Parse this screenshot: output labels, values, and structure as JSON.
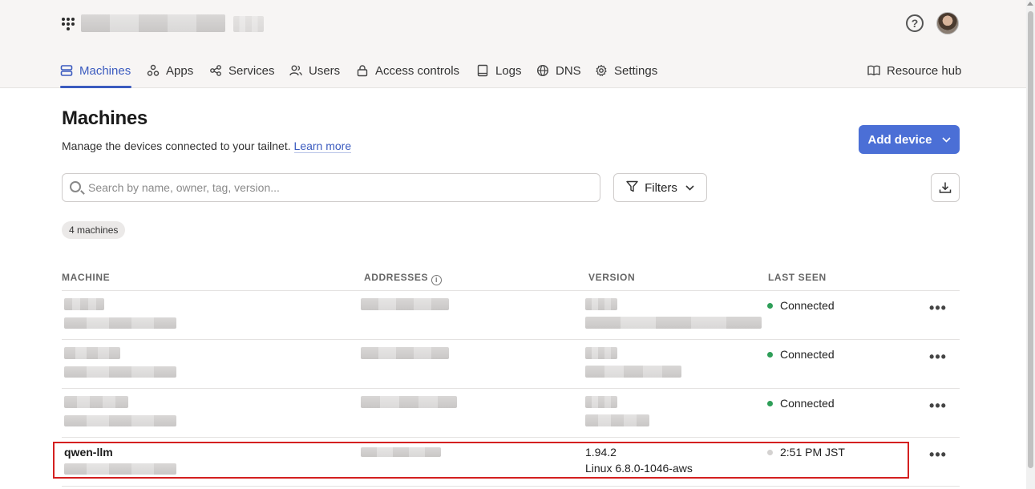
{
  "nav": {
    "items": [
      {
        "label": "Machines",
        "icon": "machines-icon",
        "active": true
      },
      {
        "label": "Apps",
        "icon": "apps-icon"
      },
      {
        "label": "Services",
        "icon": "services-icon"
      },
      {
        "label": "Users",
        "icon": "users-icon"
      },
      {
        "label": "Access controls",
        "icon": "lock-icon"
      },
      {
        "label": "Logs",
        "icon": "book-icon"
      },
      {
        "label": "DNS",
        "icon": "globe-icon"
      },
      {
        "label": "Settings",
        "icon": "gear-icon"
      }
    ],
    "resource_hub": "Resource hub",
    "help_icon": "?"
  },
  "page": {
    "title": "Machines",
    "description": "Manage the devices connected to your tailnet.",
    "learn_more": "Learn more",
    "add_device": "Add device"
  },
  "search": {
    "placeholder": "Search by name, owner, tag, version..."
  },
  "filters_label": "Filters",
  "machine_count": "4 machines",
  "table": {
    "headers": {
      "machine": "MACHINE",
      "addresses": "ADDRESSES",
      "version": "VERSION",
      "last_seen": "LAST SEEN"
    },
    "rows": [
      {
        "name": "",
        "status": "Connected",
        "online": true
      },
      {
        "name": "",
        "status": "Connected",
        "online": true
      },
      {
        "name": "",
        "status": "Connected",
        "online": true
      },
      {
        "name": "qwen-llm",
        "version": "1.94.2",
        "os": "Linux 6.8.0-1046-aws",
        "status": "2:51 PM JST",
        "online": false
      }
    ]
  },
  "colors": {
    "accent": "#3b5bbf",
    "button": "#4b6fd6",
    "online": "#2e9e58",
    "offline": "#d4d2d1",
    "highlight": "#d42020"
  }
}
